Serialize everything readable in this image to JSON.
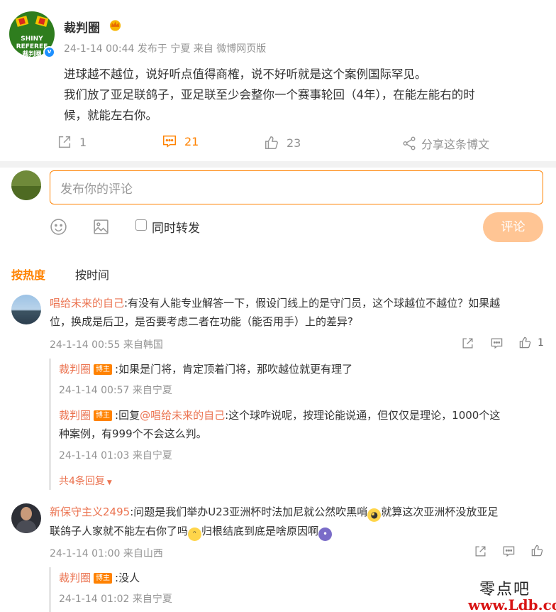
{
  "post": {
    "author": "裁判圈",
    "avatar_text": "SHINY\nREFEREE\n裁判圈",
    "verified_mark": "v",
    "meta": {
      "time": "24-1-14 00:44",
      "published_in_label": "发布于",
      "location": "宁夏",
      "from_label": "来自",
      "source": "微博网页版"
    },
    "text_lines": [
      "进球越不越位，说好听点值得商榷，说不好听就是这个案例国际罕见。",
      "我们放了亚足联鸽子，亚足联至少会整你一个赛事轮回（4年），在能左能右的时",
      "候，就能左右你。"
    ],
    "actions": {
      "repost_count": "1",
      "comment_count": "21",
      "like_count": "23",
      "share_label": "分享这条博文"
    }
  },
  "composer": {
    "placeholder": "发布你的评论",
    "also_repost_label": "同时转发",
    "submit_label": "评论"
  },
  "sort_tabs": {
    "hot": "按热度",
    "time": "按时间"
  },
  "blogger_badge": "博主",
  "comments": [
    {
      "user": "唱给未来的自己",
      "text_line1": ":有没有人能专业解答一下，假设门线上的是守门员，这个球越位不越位？如果越",
      "text_line2": "位，换成是后卫，是否要考虑二者在功能（能否用手）上的差异?",
      "meta": "24-1-14 00:55 来自韩国",
      "like_count": "1",
      "replies": [
        {
          "user": "裁判圈",
          "text": ":如果是门将，肯定顶着门将，那吹越位就更有理了",
          "meta": "24-1-14 00:57 来自宁夏"
        },
        {
          "user": "裁判圈",
          "reply_prefix": ":回复",
          "mention": "@唱给未来的自己",
          "text_line1": ":这个球咋说呢，按理论能说通，但仅仅是理论，1000个这",
          "text_line2": "种案例，有999个不会这么判。",
          "meta": "24-1-14 01:03 来自宁夏"
        }
      ],
      "more_replies": "共4条回复"
    },
    {
      "user": "新保守主义2495",
      "text_line1a": ":问题是我们举办U23亚洲杯时法加尼就公然吹黑哨",
      "text_line1b": "就算这次亚洲杯没放亚足",
      "text_line2a": "联鸽子人家就不能左右你了吗",
      "text_line2b": "归根结底到底是啥原因啊",
      "meta": "24-1-14 01:00 来自山西",
      "replies": [
        {
          "user": "裁判圈",
          "text": ":没人",
          "meta": "24-1-14 01:02 来自宁夏"
        }
      ]
    }
  ],
  "watermark": {
    "line1": "零点吧",
    "line2": "www.Ldb.cc"
  },
  "colors": {
    "accent": "#ff8200",
    "link": "#eb7350",
    "muted": "#939393",
    "submit_disabled": "#ffc594"
  }
}
